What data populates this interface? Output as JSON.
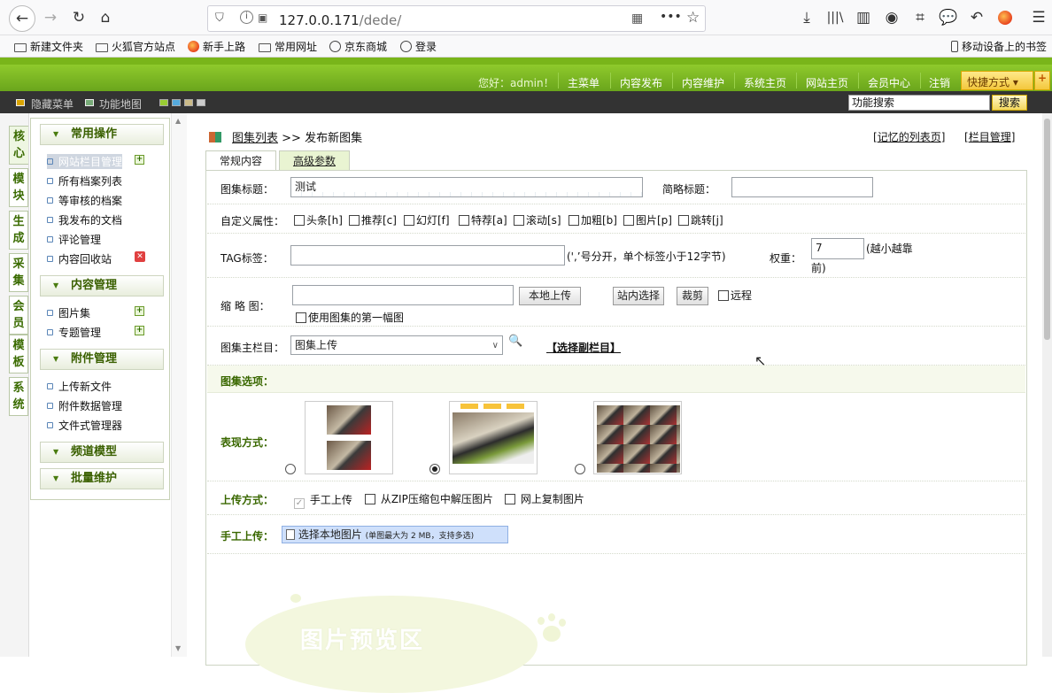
{
  "browser": {
    "url_host": "127.0.0.171",
    "url_path": "/dede/"
  },
  "bookmarks": [
    "新建文件夹",
    "火狐官方站点",
    "新手上路",
    "常用网址",
    "京东商城",
    "登录"
  ],
  "mobile_bookmarks": "移动设备上的书签",
  "header": {
    "welcome": "您好：admin！",
    "nav": [
      "主菜单",
      "内容发布",
      "内容维护",
      "系统主页",
      "网站主页",
      "会员中心",
      "注销"
    ],
    "quick": "快捷方式 ▾",
    "plus": "+"
  },
  "darkbar": {
    "hide_menu": "隐藏菜单",
    "func_map": "功能地图",
    "search_value": "功能搜索",
    "search_btn": "搜索"
  },
  "left_tabs": [
    "核心",
    "模块",
    "生成",
    "采集",
    "会员",
    "模板",
    "系统"
  ],
  "menu": {
    "groups": [
      "常用操作",
      "内容管理",
      "附件管理",
      "频道模型",
      "批量维护"
    ],
    "common": [
      "网站栏目管理",
      "所有档案列表",
      "等审核的档案",
      "我发布的文档",
      "评论管理",
      "内容回收站"
    ],
    "content": [
      "图片集",
      "专题管理"
    ],
    "attach": [
      "上传新文件",
      "附件数据管理",
      "文件式管理器"
    ]
  },
  "crumb": {
    "list": "图集列表",
    "sep": ">>",
    "current": "发布新图集"
  },
  "right_links": [
    "记忆的列表页",
    "栏目管理"
  ],
  "tabs": [
    "常规内容",
    "高级参数"
  ],
  "form": {
    "title_label": "图集标题：",
    "title_value": "测试",
    "short_title_label": "简略标题：",
    "attr_label": "自定义属性：",
    "attrs": [
      "头条[h]",
      "推荐[c]",
      "幻灯[f]",
      "特荐[a]",
      "滚动[s]",
      "加粗[b]",
      "图片[p]",
      "跳转[j]"
    ],
    "tag_label": "TAG标签：",
    "tag_hint": "(',’号分开，单个标签小于12字节)",
    "weight_label": "权重：",
    "weight_value": "7",
    "weight_hint_1": "(越小越靠",
    "weight_hint_2": "前)",
    "thumb_label": "缩 略 图：",
    "local_upload": "本地上传",
    "site_select": "站内选择",
    "crop": "裁剪",
    "remote": "远程",
    "use_first": "使用图集的第一幅图",
    "column_label": "图集主栏目：",
    "column_value": "图集上传",
    "select_sub": "【选择副栏目】",
    "options_label": "图集选项：",
    "display_label": "表现方式：",
    "upload_mode_label": "上传方式：",
    "upload_modes": [
      "手工上传",
      "从ZIP压缩包中解压图片",
      "网上复制图片"
    ],
    "manual_label": "手工上传：",
    "choose_local": "选择本地图片",
    "choose_hint": "(单图最大为 2 MB，支持多选)",
    "preview_area": "图片预览区"
  }
}
